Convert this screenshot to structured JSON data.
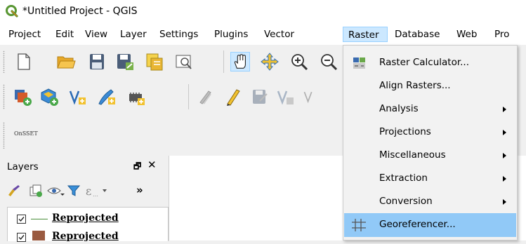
{
  "window": {
    "title": "*Untitled Project - QGIS"
  },
  "menubar": {
    "items": [
      "Project",
      "Edit",
      "View",
      "Layer",
      "Settings",
      "Plugins",
      "Vector",
      "Raster",
      "Database",
      "Web",
      "Pro"
    ],
    "active": "Raster"
  },
  "toolbar": {
    "plugin_label": "OnSSET"
  },
  "layers_panel": {
    "title": "Layers",
    "float_glyph": "🗗",
    "close_glyph": "✕",
    "overflow_glyph": "»",
    "layers": [
      {
        "name": "Reprojected",
        "checked": true,
        "symbol": "line"
      },
      {
        "name": "Reprojected",
        "checked": true,
        "symbol": "fill",
        "color": "#9a5a40"
      }
    ]
  },
  "raster_menu": {
    "items": [
      {
        "label": "Raster Calculator...",
        "submenu": false,
        "icon": "raster-calculator-icon"
      },
      {
        "label": "Align Rasters...",
        "submenu": false
      },
      {
        "label": "Analysis",
        "submenu": true
      },
      {
        "label": "Projections",
        "submenu": true
      },
      {
        "label": "Miscellaneous",
        "submenu": true
      },
      {
        "label": "Extraction",
        "submenu": true
      },
      {
        "label": "Conversion",
        "submenu": true
      },
      {
        "label": "Georeferencer...",
        "submenu": false,
        "icon": "georeferencer-icon",
        "highlighted": true
      }
    ]
  },
  "colors": {
    "highlight": "#91c9f7",
    "menu_active": "#cce8ff",
    "qgis_green": "#589632"
  }
}
